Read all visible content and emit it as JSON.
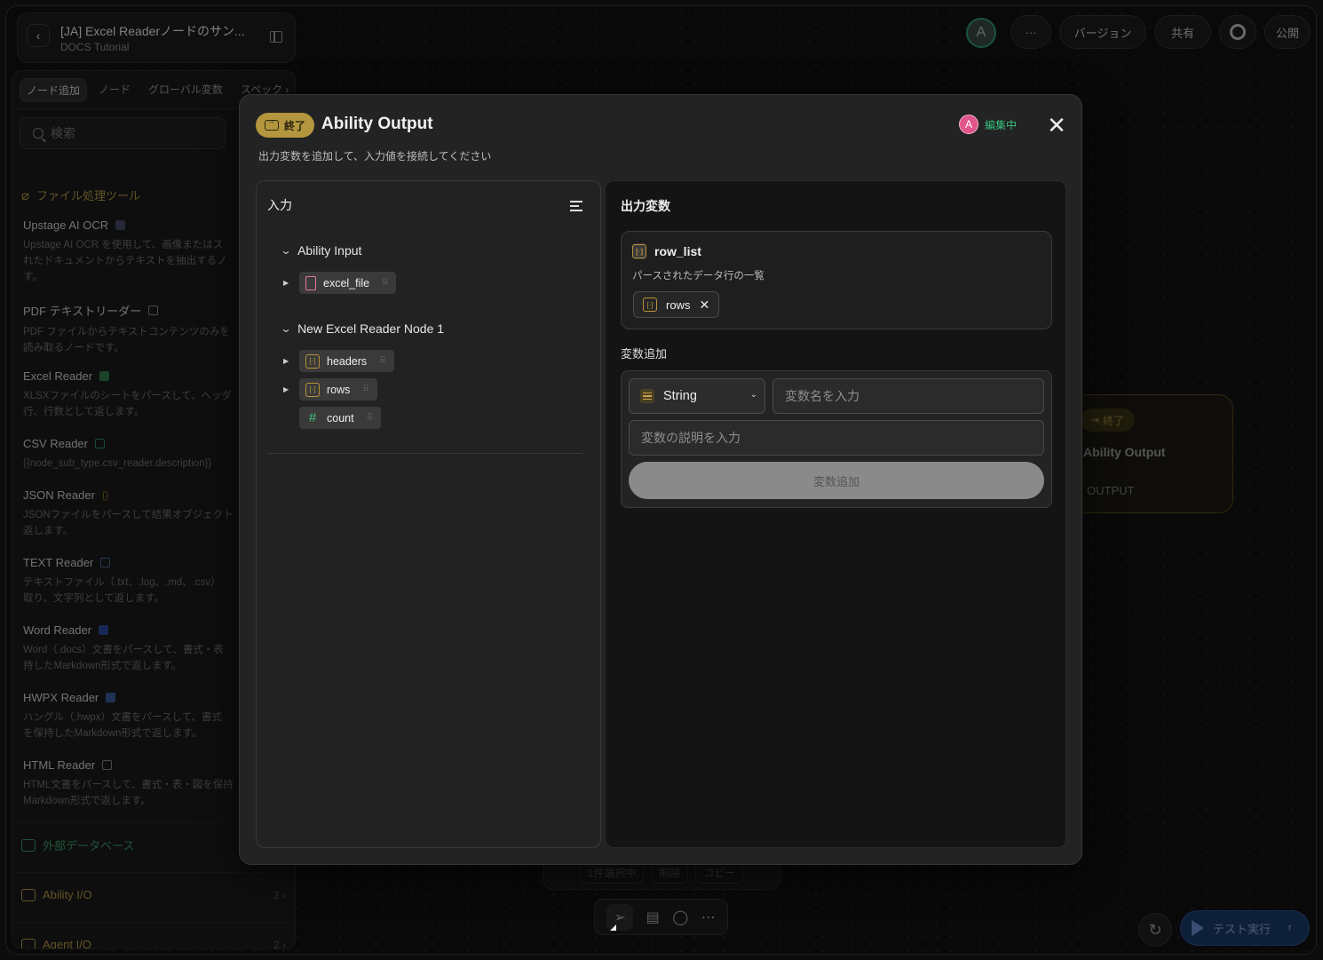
{
  "header": {
    "title": "[JA] Excel Readerノードのサン...",
    "subtitle": "DOCS Tutorial"
  },
  "topbar": {
    "avatar": "A",
    "more": "···",
    "version": "バージョン",
    "share": "共有",
    "publish": "公開"
  },
  "sidebar": {
    "tabs": [
      "ノード追加",
      "ノード",
      "グローバル変数",
      "スペック ›"
    ],
    "search_placeholder": "検索",
    "category_file": "ファイル処理ツール",
    "items": [
      {
        "name": "Upstage AI OCR",
        "desc": "Upstage AI OCR を使用して、画像またはス\nれたドキュメントからテキストを抽出するノ\nす。",
        "color": "#444a66"
      },
      {
        "name": "PDF テキストリーダー",
        "desc": "PDF ファイルからテキストコンテンツのみを\n読み取るノードです。",
        "color": "#555555"
      },
      {
        "name": "Excel Reader",
        "desc": "XLSXファイルのシートをパースして、ヘッダ\n行、行数として返します。",
        "color": "#2f7a4a"
      },
      {
        "name": "CSV Reader",
        "desc": "{{node_sub_type.csv_reader.description}}",
        "color": "#2f6a4a"
      },
      {
        "name": "JSON Reader",
        "desc": "JSONファイルをパースして結果オブジェクト\n返します。",
        "color": "#8a6a2a"
      },
      {
        "name": "TEXT Reader",
        "desc": "テキストファイル（.txt、.log、.md、.csv）\n取り、文字列として返します。",
        "color": "#3a5a8a"
      },
      {
        "name": "Word Reader",
        "desc": "Word（.docs）文書をパースして、書式・表\n持したMarkdown形式で返します。",
        "color": "#2a4a9a"
      },
      {
        "name": "HWPX Reader",
        "desc": "ハングル（.hwpx）文書をパースして、書式\nを保持したMarkdown形式で返します。",
        "color": "#3a5a9a"
      },
      {
        "name": "HTML Reader",
        "desc": "HTML文書をパースして、書式・表・図を保持\nMarkdown形式で返します。",
        "color": "#666666"
      }
    ],
    "category_db": "外部データベース",
    "ability_io": {
      "label": "Ability I/O",
      "count": "2"
    },
    "agent_io": {
      "label": "Agent I/O",
      "count": "2"
    }
  },
  "bg_node": {
    "tag": "終了",
    "title": "Ability Output",
    "output": "OUTPUT"
  },
  "selection_bar": {
    "selected": "1件選択中",
    "delete": "削除",
    "copy": "コピー"
  },
  "run": {
    "label": "テスト実行",
    "shortcut": "r"
  },
  "modal": {
    "badge": "終了",
    "title": "Ability Output",
    "desc": "出力変数を追加して、入力値を接続してください",
    "editing": {
      "avatar": "A",
      "label": "編集中"
    },
    "close": "✕",
    "input_panel": {
      "header": "入力",
      "groups": [
        {
          "name": "Ability Input",
          "vars": [
            {
              "name": "excel_file",
              "type": "file"
            }
          ]
        },
        {
          "name": "New Excel Reader Node 1",
          "vars": [
            {
              "name": "headers",
              "type": "array"
            },
            {
              "name": "rows",
              "type": "array"
            },
            {
              "name": "count",
              "type": "number"
            }
          ]
        }
      ]
    },
    "output_panel": {
      "header": "出力変数",
      "variable": {
        "name": "row_list",
        "desc": "パースされたデータ行の一覧",
        "connected": "rows"
      },
      "add_label": "変数追加",
      "type_select": "String",
      "name_placeholder": "変数名を入力",
      "desc_placeholder": "変数の説明を入力",
      "add_button": "変数追加"
    }
  }
}
